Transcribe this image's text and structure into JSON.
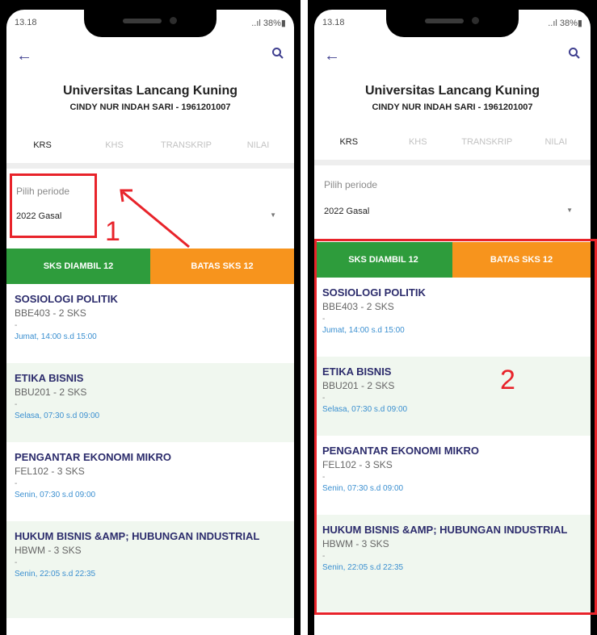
{
  "phones": [
    {
      "status": {
        "time": "13.18",
        "signal": "..ıl 38%▮"
      },
      "university": "Universitas Lancang Kuning",
      "student": "CINDY NUR INDAH SARI - 1961201007",
      "tabs": [
        "KRS",
        "KHS",
        "TRANSKRIP",
        "NILAI"
      ],
      "period": {
        "label": "Pilih periode",
        "value": "2022 Gasal"
      },
      "summary": {
        "taken": "SKS DIAMBIL 12",
        "limit": "BATAS SKS 12"
      },
      "courses": [
        {
          "title": "SOSIOLOGI POLITIK",
          "code": "BBE403 - 2 SKS",
          "dash": "-",
          "schedule": "Jumat, 14:00 s.d 15:00"
        },
        {
          "title": "ETIKA BISNIS",
          "code": "BBU201 - 2 SKS",
          "dash": "-",
          "schedule": "Selasa, 07:30 s.d 09:00"
        },
        {
          "title": "PENGANTAR EKONOMI MIKRO",
          "code": "FEL102 - 3 SKS",
          "dash": "-",
          "schedule": "Senin, 07:30 s.d 09:00"
        },
        {
          "title": "HUKUM BISNIS &AMP; HUBUNGAN INDUSTRIAL",
          "code": "HBWM - 3 SKS",
          "dash": "-",
          "schedule": "Senin, 22:05 s.d 22:35"
        }
      ]
    },
    {
      "status": {
        "time": "13.18",
        "signal": "..ıl 38%▮"
      },
      "university": "Universitas Lancang Kuning",
      "student": "CINDY NUR INDAH SARI - 1961201007",
      "tabs": [
        "KRS",
        "KHS",
        "TRANSKRIP",
        "NILAI"
      ],
      "period": {
        "label": "Pilih periode",
        "value": "2022 Gasal"
      },
      "summary": {
        "taken": "SKS DIAMBIL 12",
        "limit": "BATAS SKS 12"
      },
      "courses": [
        {
          "title": "SOSIOLOGI POLITIK",
          "code": "BBE403 - 2 SKS",
          "dash": "-",
          "schedule": "Jumat, 14:00 s.d 15:00"
        },
        {
          "title": "ETIKA BISNIS",
          "code": "BBU201 - 2 SKS",
          "dash": "-",
          "schedule": "Selasa, 07:30 s.d 09:00"
        },
        {
          "title": "PENGANTAR EKONOMI MIKRO",
          "code": "FEL102 - 3 SKS",
          "dash": "-",
          "schedule": "Senin, 07:30 s.d 09:00"
        },
        {
          "title": "HUKUM BISNIS &AMP; HUBUNGAN INDUSTRIAL",
          "code": "HBWM - 3 SKS",
          "dash": "-",
          "schedule": "Senin, 22:05 s.d 22:35"
        }
      ]
    }
  ],
  "annotations": {
    "label_1": "1",
    "label_2": "2",
    "highlight_color": "#e8232a"
  },
  "colors": {
    "green": "#2e9c3c",
    "orange": "#f7941d",
    "title": "#2c2c6c",
    "schedule": "#3a8fd0"
  },
  "icons": {
    "back": "arrow-left-icon",
    "search": "search-icon",
    "dropdown": "caret-down-icon"
  }
}
